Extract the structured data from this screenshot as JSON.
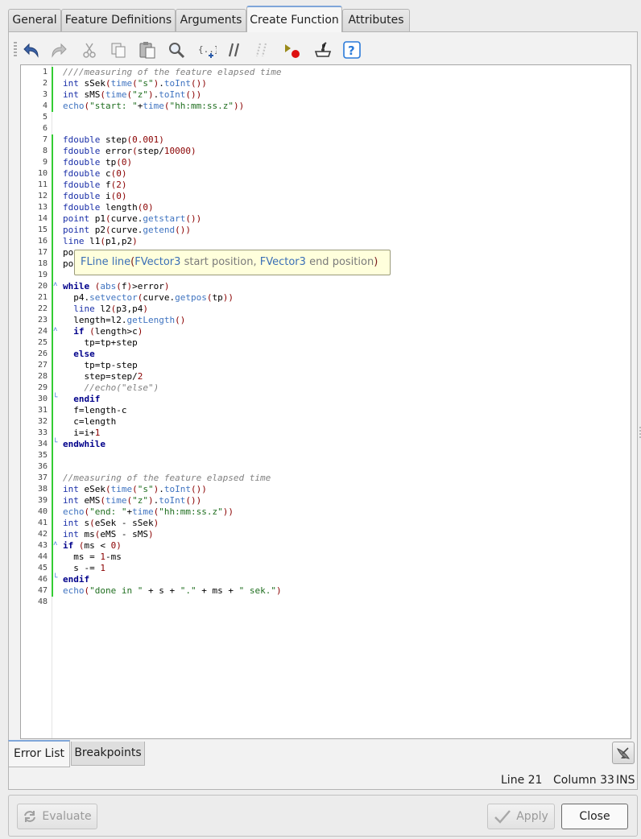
{
  "tabs": [
    {
      "label": "General"
    },
    {
      "label": "Feature Definitions"
    },
    {
      "label": "Arguments"
    },
    {
      "label": "Create Function",
      "active": true
    },
    {
      "label": "Attributes"
    }
  ],
  "toolbar": {
    "icons": [
      "undo-icon",
      "redo-icon",
      "cut-icon",
      "copy-icon",
      "paste-icon",
      "find-icon",
      "insert-template-icon",
      "comment-icon",
      "uncomment-icon",
      "add-breakpoint-icon",
      "run-to-cursor-icon",
      "help-icon"
    ]
  },
  "colors": {
    "accent": "#7fa6d9",
    "change_marker": "#33cc33",
    "tooltip_bg": "#ffffdc"
  },
  "editor": {
    "lines": [
      "////measuring of the feature elapsed time",
      "int sSek(time(\"s\").toInt())",
      "int sMS(time(\"z\").toInt())",
      "echo(\"start: \"+time(\"hh:mm:ss.z\"))",
      "",
      "",
      "fdouble step(0.001)",
      "fdouble error(step/10000)",
      "fdouble tp(0)",
      "fdouble c(0)",
      "fdouble f(2)",
      "fdouble i(0)",
      "fdouble length(0)",
      "point p1(curve.getstart())",
      "point p2(curve.getend())",
      "line l1(p1,p2)",
      "po",
      "po",
      "",
      "while (abs(f)>error)",
      "  p4.setvector(curve.getpos(tp))",
      "  line l2(p3,p4)",
      "  length=l2.getLength()",
      "  if (length>c)",
      "    tp=tp+step",
      "  else",
      "    tp=tp-step",
      "    step=step/2",
      "    //echo(\"else\")",
      "  endif",
      "  f=length-c",
      "  c=length",
      "  i=i+1",
      "endwhile",
      "",
      "",
      "//measuring of the feature elapsed time",
      "int eSek(time(\"s\").toInt())",
      "int eMS(time(\"z\").toInt())",
      "echo(\"end: \"+time(\"hh:mm:ss.z\"))",
      "int s(eSek - sSek)",
      "int ms(eMS - sMS)",
      "if (ms < 0)",
      "  ms = 1-ms",
      "  s -= 1",
      "endif",
      "echo(\"done in \" + s + \".\" + ms + \" sek.\")",
      ""
    ]
  },
  "tooltip": {
    "return_type": "FLine",
    "name": " line",
    "open": "(",
    "param1_type": "FVector3",
    "param1_name": " start position",
    "sep": ", ",
    "param2_type": "FVector3",
    "param2_name": " end position",
    "close": ")"
  },
  "bottom_tabs": [
    {
      "label": "Error List",
      "active": true
    },
    {
      "label": "Breakpoints"
    }
  ],
  "status": {
    "line": "Line 21",
    "column": "Column 33",
    "mode": "INS"
  },
  "buttons": {
    "evaluate": "Evaluate",
    "apply": "Apply",
    "close": "Close"
  }
}
